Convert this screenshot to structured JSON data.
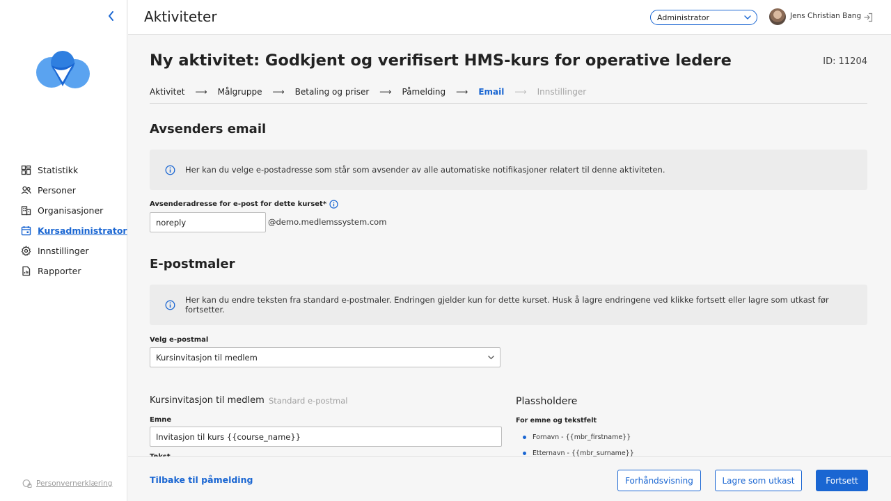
{
  "app": {
    "page_title": "Aktiviteter"
  },
  "header": {
    "role_selected": "Administrator",
    "user_name": "Jens Christian Bang"
  },
  "sidebar": {
    "items": [
      {
        "label": "Statistikk",
        "icon": "dashboard-icon"
      },
      {
        "label": "Personer",
        "icon": "people-icon"
      },
      {
        "label": "Organisasjoner",
        "icon": "building-icon"
      },
      {
        "label": "Kursadministrator",
        "icon": "calendar-icon",
        "active": true
      },
      {
        "label": "Innstillinger",
        "icon": "gear-icon"
      },
      {
        "label": "Rapporter",
        "icon": "report-icon"
      }
    ],
    "privacy_label": "Personvernerklæring"
  },
  "activity": {
    "heading": "Ny aktivitet: Godkjent og verifisert HMS-kurs for operative ledere",
    "id_label": "ID: 11204"
  },
  "stepper": {
    "steps": [
      {
        "label": "Aktivitet",
        "state": "done"
      },
      {
        "label": "Målgruppe",
        "state": "done"
      },
      {
        "label": "Betaling og priser",
        "state": "done"
      },
      {
        "label": "Påmelding",
        "state": "done"
      },
      {
        "label": "Email",
        "state": "current"
      },
      {
        "label": "Innstillinger",
        "state": "future"
      }
    ],
    "arrow": "⟶"
  },
  "sender": {
    "section_title": "Avsenders email",
    "info_text": "Her kan du velge e-postadresse som står som avsender av alle automatiske notifikasjoner relatert til denne aktiviteten.",
    "field_label": "Avsenderadresse for e-post for dette kurset*",
    "field_value": "noreply",
    "domain_suffix": "@demo.medlemssystem.com"
  },
  "templates": {
    "section_title": "E-postmaler",
    "info_text": "Her kan du endre teksten fra standard e-postmaler. Endringen gjelder kun for dette kurset. Husk å lagre endringene ved klikke fortsett eller lagre som utkast før fortsetter.",
    "select_label": "Velg e-postmal",
    "select_value": "Kursinvitasjon til medlem",
    "template_title": "Kursinvitasjon til medlem",
    "template_subtitle": "Standard e-postmal",
    "subject_label": "Emne",
    "subject_value": "Invitasjon til kurs {{course_name}}",
    "next_label": "Tekst"
  },
  "placeholders": {
    "title": "Plassholdere",
    "subtitle": "For emne og tekstfelt",
    "items": [
      "Fornavn - {{mbr_firstname}}",
      "Etternavn - {{mbr_surname}}"
    ]
  },
  "footer": {
    "back_label": "Tilbake til påmelding",
    "preview_label": "Forhåndsvisning",
    "draft_label": "Lagre som utkast",
    "continue_label": "Fortsett"
  },
  "colors": {
    "accent": "#1a66d2",
    "background": "#f6f6f6",
    "info_box": "#ececec"
  }
}
